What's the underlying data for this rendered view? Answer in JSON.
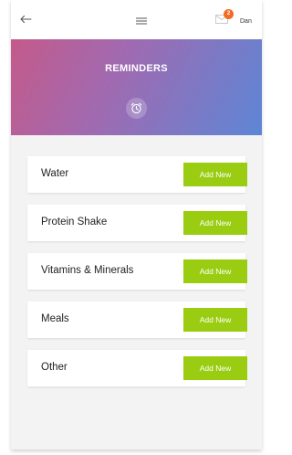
{
  "topbar": {
    "back_icon": "arrow-left-icon",
    "menu_icon": "hamburger-menu-icon",
    "mail_icon": "envelope-icon",
    "notification_count": "2",
    "user_name": "Dan"
  },
  "hero": {
    "title": "REMINDERS",
    "icon": "alarm-clock-icon",
    "gradient_colors": [
      "#c45a8a",
      "#a16ab0",
      "#5d86d6"
    ]
  },
  "reminders": [
    {
      "label": "Water",
      "button": "Add New"
    },
    {
      "label": "Protein Shake",
      "button": "Add New"
    },
    {
      "label": "Vitamins & Minerals",
      "button": "Add New"
    },
    {
      "label": "Meals",
      "button": "Add New"
    },
    {
      "label": "Other",
      "button": "Add New"
    }
  ],
  "colors": {
    "accent_button": "#9acd12",
    "badge": "#f36a24"
  }
}
